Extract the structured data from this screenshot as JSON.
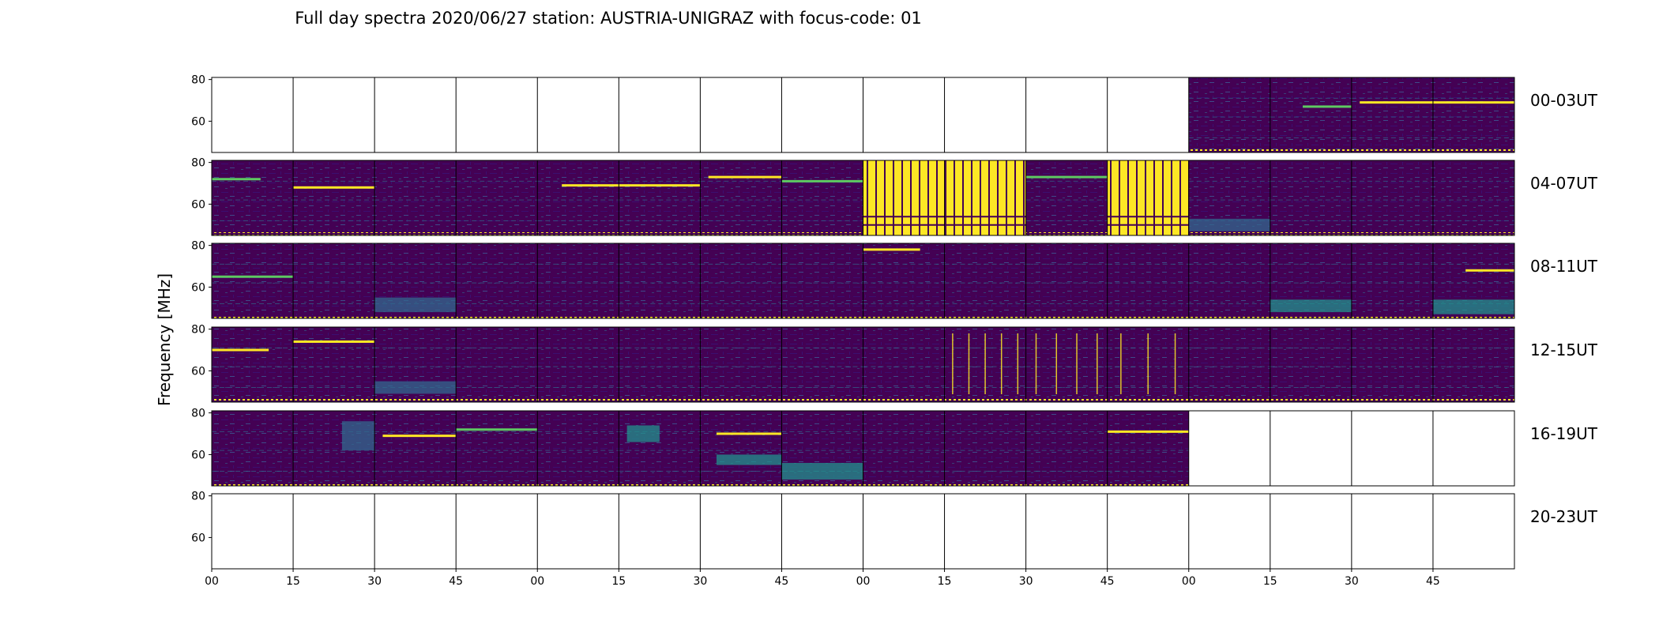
{
  "chart_data": {
    "type": "heatmap",
    "title": "Full day spectra 2020/06/27 station: AUSTRIA-UNIGRAZ with focus-code: 01",
    "ylabel": "Frequency [MHz]",
    "xlabel": "",
    "ylim": [
      45,
      81
    ],
    "yticks": [
      60,
      80
    ],
    "xticks": [
      "00",
      "15",
      "30",
      "45",
      "00",
      "15",
      "30",
      "45",
      "00",
      "15",
      "30",
      "45",
      "00",
      "15",
      "30",
      "45"
    ],
    "colormap": "viridis",
    "colors": {
      "background": "#440154",
      "dark": "#3b0f70",
      "mid_blue": "#31688e",
      "teal": "#21918c",
      "green": "#5ec962",
      "yellow": "#fde725"
    },
    "rows": [
      {
        "label": "00-03UT",
        "panels": [
          "empty",
          "empty",
          "empty",
          "empty",
          "empty",
          "empty",
          "empty",
          "empty",
          "empty",
          "empty",
          "empty",
          "empty",
          "data",
          "data",
          "data",
          "data"
        ],
        "features": [
          {
            "panel": 13,
            "type": "band",
            "freq": 67,
            "t0": 0.4,
            "t1": 1.0,
            "color": "green"
          },
          {
            "panel": 14,
            "type": "band",
            "freq": 69,
            "t0": 0.1,
            "t1": 1.0,
            "color": "yellow"
          },
          {
            "panel": 15,
            "type": "band",
            "freq": 69,
            "t0": 0.0,
            "t1": 1.0,
            "color": "yellow"
          }
        ]
      },
      {
        "label": "04-07UT",
        "panels": [
          "data",
          "data",
          "data",
          "data",
          "data",
          "data",
          "data",
          "data",
          "saturated",
          "saturated",
          "data",
          "saturated",
          "data",
          "data",
          "data",
          "data"
        ],
        "features": [
          {
            "panel": 0,
            "type": "band",
            "freq": 72,
            "t0": 0.0,
            "t1": 0.6,
            "color": "green"
          },
          {
            "panel": 1,
            "type": "band",
            "freq": 68,
            "t0": 0.0,
            "t1": 1.0,
            "color": "yellow"
          },
          {
            "panel": 4,
            "type": "band",
            "freq": 69,
            "t0": 0.3,
            "t1": 1.0,
            "color": "yellow"
          },
          {
            "panel": 5,
            "type": "band",
            "freq": 69,
            "t0": 0.0,
            "t1": 1.0,
            "color": "yellow"
          },
          {
            "panel": 6,
            "type": "band",
            "freq": 73,
            "t0": 0.1,
            "t1": 1.0,
            "color": "yellow"
          },
          {
            "panel": 7,
            "type": "band",
            "freq": 71,
            "t0": 0.0,
            "t1": 1.0,
            "color": "green"
          },
          {
            "panel": 10,
            "type": "band",
            "freq": 73,
            "t0": 0.0,
            "t1": 1.0,
            "color": "green"
          },
          {
            "panel": 12,
            "type": "block",
            "f0": 47,
            "f1": 53,
            "t0": 0.0,
            "t1": 1.0,
            "color": "mid_blue"
          }
        ]
      },
      {
        "label": "08-11UT",
        "panels": [
          "data",
          "data",
          "data",
          "data",
          "data",
          "data",
          "data",
          "data",
          "data",
          "data",
          "data",
          "data",
          "data",
          "data",
          "data",
          "data"
        ],
        "features": [
          {
            "panel": 0,
            "type": "band",
            "freq": 65,
            "t0": 0.0,
            "t1": 1.0,
            "color": "green"
          },
          {
            "panel": 2,
            "type": "block",
            "f0": 48,
            "f1": 55,
            "t0": 0.0,
            "t1": 1.0,
            "color": "mid_blue"
          },
          {
            "panel": 8,
            "type": "band",
            "freq": 78,
            "t0": 0.0,
            "t1": 0.7,
            "color": "yellow"
          },
          {
            "panel": 13,
            "type": "block",
            "f0": 48,
            "f1": 54,
            "t0": 0.0,
            "t1": 1.0,
            "color": "teal"
          },
          {
            "panel": 15,
            "type": "band",
            "freq": 68,
            "t0": 0.4,
            "t1": 1.0,
            "color": "yellow"
          },
          {
            "panel": 15,
            "type": "block",
            "f0": 47,
            "f1": 54,
            "t0": 0.0,
            "t1": 1.0,
            "color": "teal"
          }
        ]
      },
      {
        "label": "12-15UT",
        "panels": [
          "data",
          "data",
          "data",
          "data",
          "data",
          "data",
          "data",
          "data",
          "data",
          "data",
          "data",
          "data",
          "data",
          "data",
          "data",
          "data"
        ],
        "features": [
          {
            "panel": 0,
            "type": "band",
            "freq": 70,
            "t0": 0.0,
            "t1": 0.7,
            "color": "yellow"
          },
          {
            "panel": 1,
            "type": "band",
            "freq": 74,
            "t0": 0.0,
            "t1": 1.0,
            "color": "yellow"
          },
          {
            "panel": 2,
            "type": "block",
            "f0": 49,
            "f1": 55,
            "t0": 0.0,
            "t1": 1.0,
            "color": "mid_blue"
          },
          {
            "panel": 9,
            "type": "vlines",
            "count": 5,
            "color": "yellow"
          },
          {
            "panel": 10,
            "type": "vlines",
            "count": 4,
            "color": "yellow"
          },
          {
            "panel": 11,
            "type": "vlines",
            "count": 3,
            "color": "yellow"
          }
        ]
      },
      {
        "label": "16-19UT",
        "panels": [
          "data",
          "data",
          "data",
          "data",
          "data",
          "data",
          "data",
          "data",
          "data",
          "data",
          "data",
          "data",
          "empty",
          "empty",
          "empty",
          "empty"
        ],
        "features": [
          {
            "panel": 1,
            "type": "block",
            "f0": 62,
            "f1": 76,
            "t0": 0.6,
            "t1": 1.0,
            "color": "mid_blue"
          },
          {
            "panel": 2,
            "type": "band",
            "freq": 69,
            "t0": 0.1,
            "t1": 1.0,
            "color": "yellow"
          },
          {
            "panel": 3,
            "type": "band",
            "freq": 72,
            "t0": 0.0,
            "t1": 1.0,
            "color": "green"
          },
          {
            "panel": 5,
            "type": "block",
            "f0": 66,
            "f1": 74,
            "t0": 0.1,
            "t1": 0.5,
            "color": "teal"
          },
          {
            "panel": 6,
            "type": "band",
            "freq": 70,
            "t0": 0.2,
            "t1": 1.0,
            "color": "yellow"
          },
          {
            "panel": 6,
            "type": "block",
            "f0": 55,
            "f1": 60,
            "t0": 0.2,
            "t1": 1.0,
            "color": "teal"
          },
          {
            "panel": 7,
            "type": "block",
            "f0": 48,
            "f1": 56,
            "t0": 0.0,
            "t1": 1.0,
            "color": "teal"
          },
          {
            "panel": 11,
            "type": "band",
            "freq": 71,
            "t0": 0.0,
            "t1": 1.0,
            "color": "yellow"
          }
        ]
      },
      {
        "label": "20-23UT",
        "panels": [
          "empty",
          "empty",
          "empty",
          "empty",
          "empty",
          "empty",
          "empty",
          "empty",
          "empty",
          "empty",
          "empty",
          "empty",
          "empty",
          "empty",
          "empty",
          "empty"
        ],
        "features": []
      }
    ]
  }
}
